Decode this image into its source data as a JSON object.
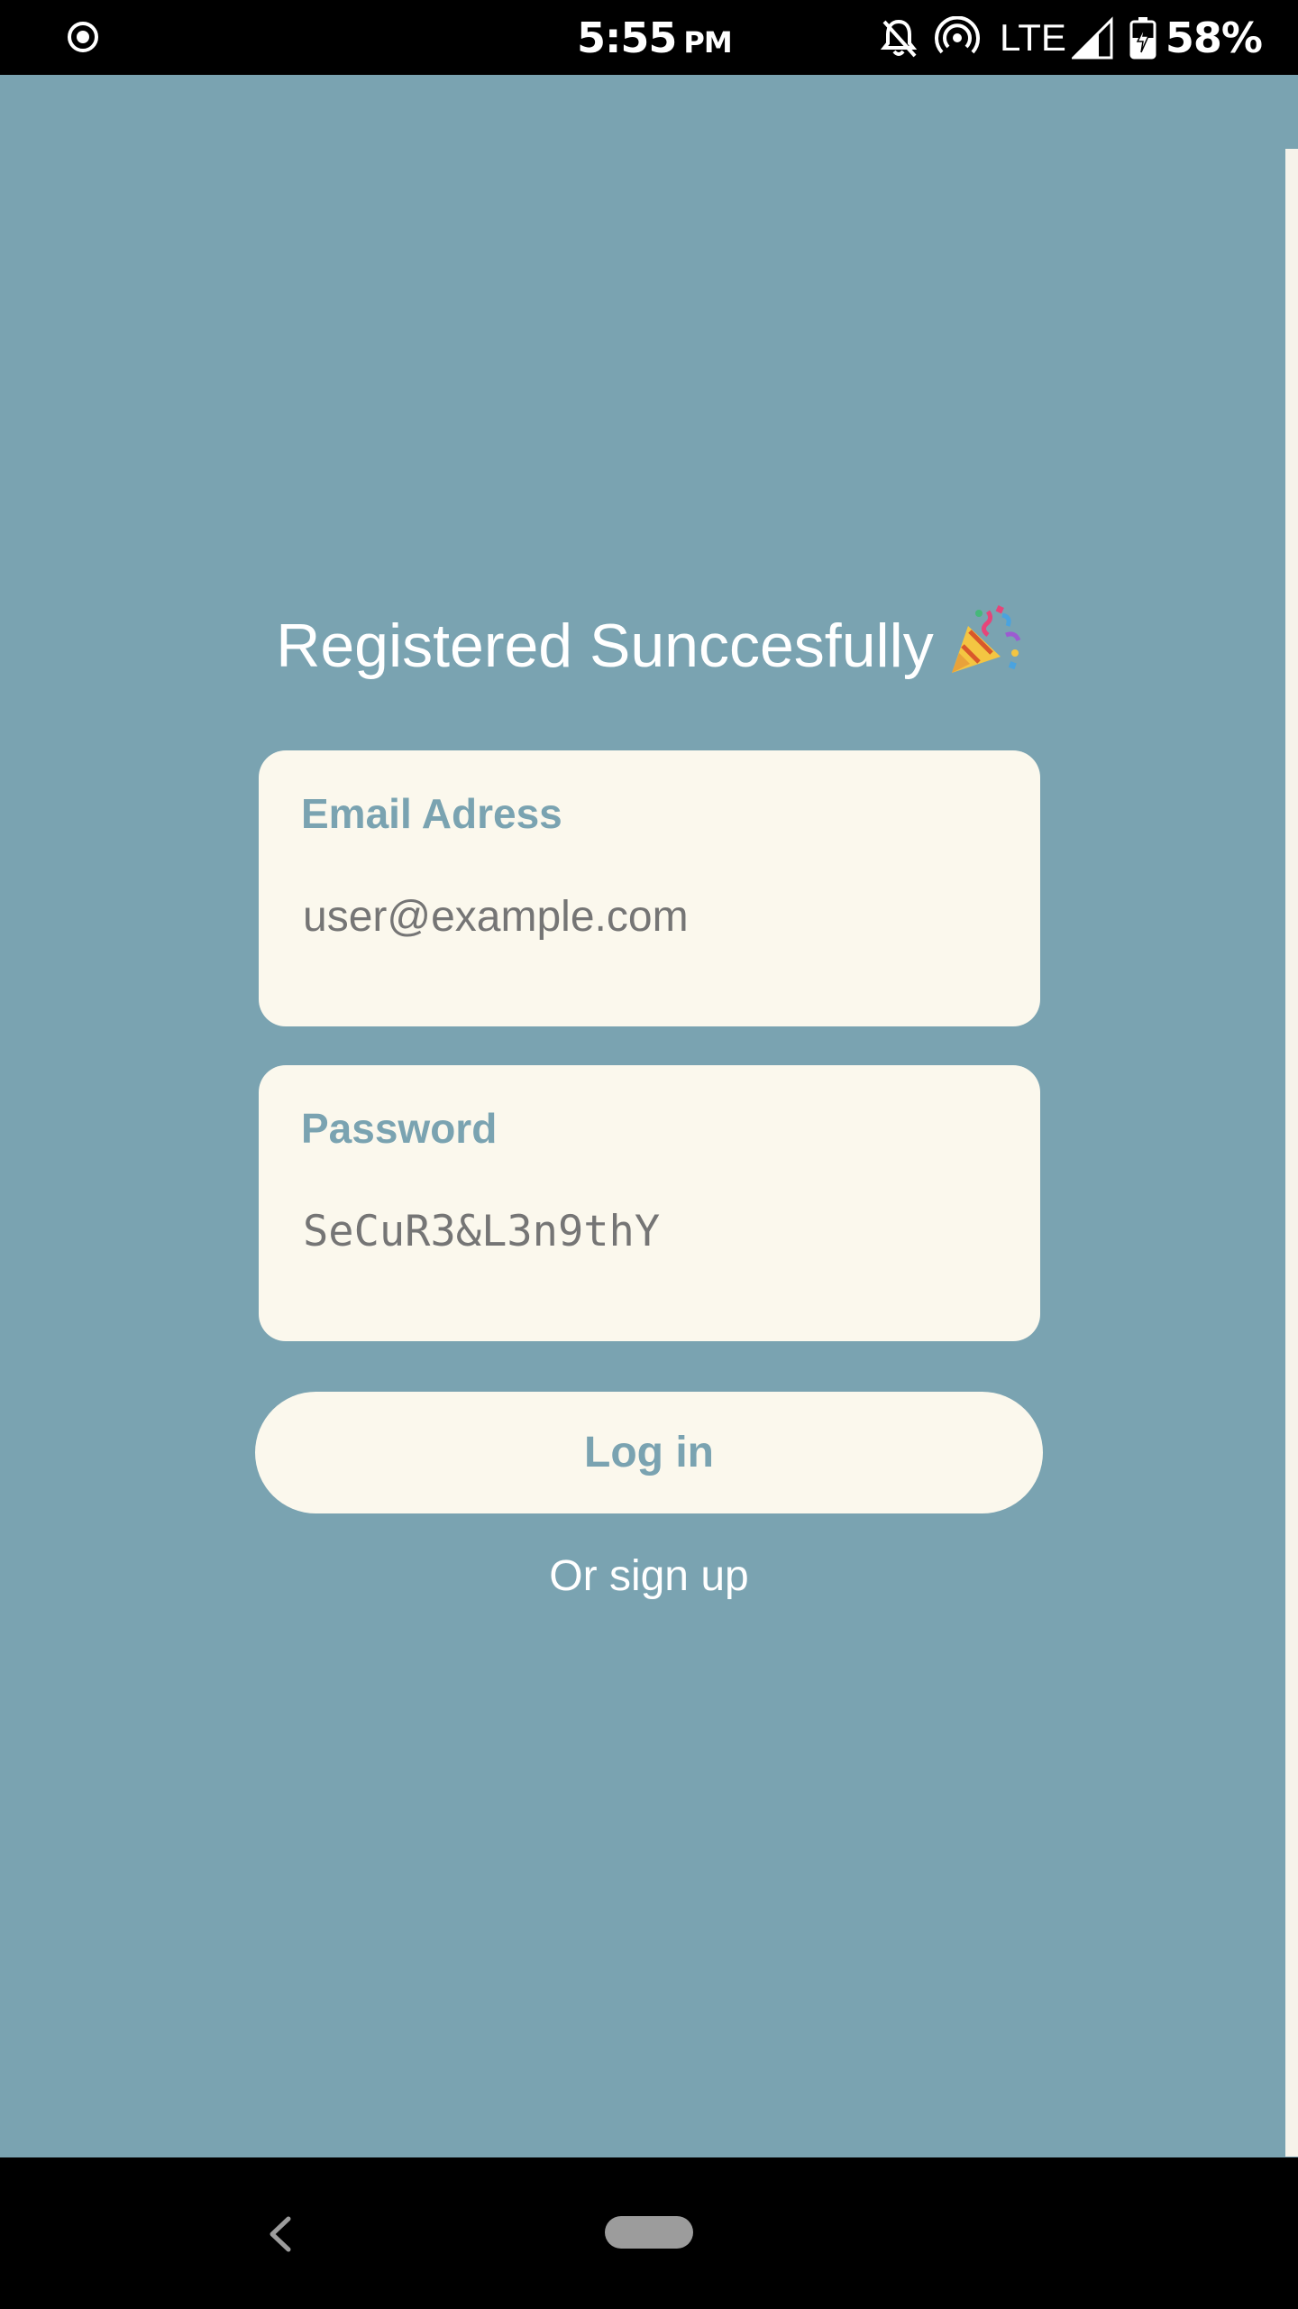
{
  "status_bar": {
    "time": "5:55",
    "ampm": "PM",
    "network": "LTE",
    "battery": "58%",
    "icons": [
      "record-icon",
      "bell-off-icon",
      "hotspot-icon",
      "signal-icon",
      "battery-charging-icon"
    ]
  },
  "title": "Registered Sunccesfully",
  "title_emoji": "🎉",
  "email_field": {
    "label": "Email Adress",
    "placeholder": "user@example.com",
    "value": ""
  },
  "password_field": {
    "label": "Password",
    "placeholder": "SeCuR3&L3n9thY",
    "value": ""
  },
  "login_button": {
    "label": "Log in"
  },
  "signup_link": {
    "label": "Or sign up"
  },
  "colors": {
    "background": "#7aa3b1",
    "card": "#fbf8ed",
    "accent": "#7aa3b1",
    "text_light": "#ffffff"
  }
}
